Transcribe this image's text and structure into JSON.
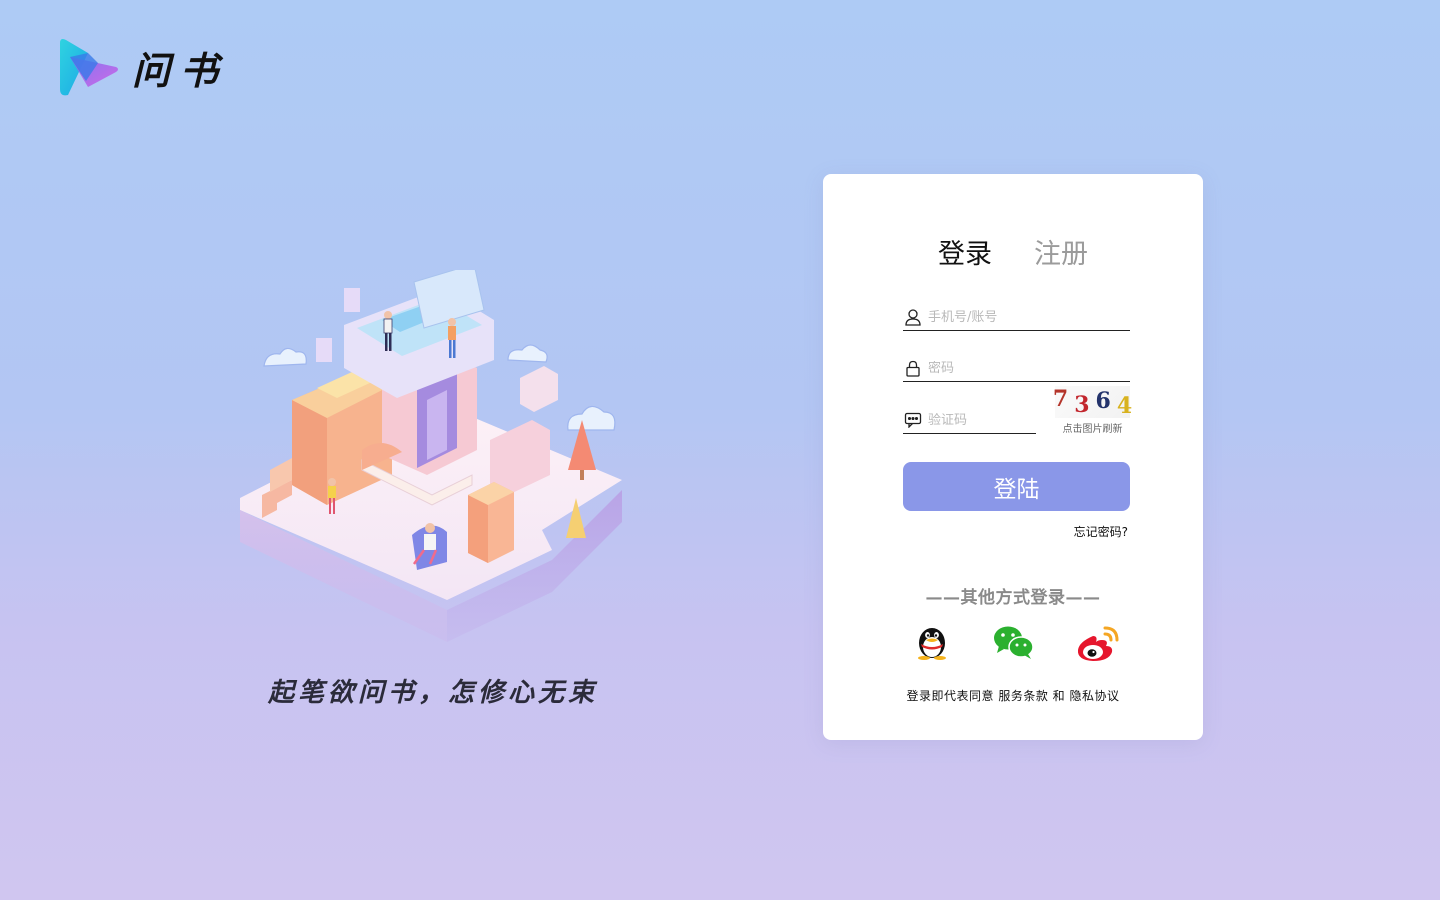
{
  "brand": {
    "name": "问书",
    "icon": "play-logo-icon"
  },
  "illustration": {
    "icon": "isometric-city-illustration"
  },
  "slogan": "起笔欲问书，怎修心无束",
  "auth": {
    "tabs": [
      {
        "label": "登录",
        "active": true
      },
      {
        "label": "注册",
        "active": false
      }
    ],
    "account_placeholder": "手机号/账号",
    "password_placeholder": "密码",
    "code_placeholder": "验证码",
    "captcha": {
      "digits": [
        "7",
        "3",
        "6",
        "4"
      ],
      "hint": "点击图片刷新"
    },
    "submit_label": "登陆",
    "forgot_label": "忘记密码?",
    "other_login_title": "——其他方式登录——",
    "socials": [
      {
        "name": "qq-icon"
      },
      {
        "name": "wechat-icon"
      },
      {
        "name": "weibo-icon"
      }
    ],
    "agreement": {
      "prefix": "登录即代表同意",
      "terms": "服务条款",
      "and": "和",
      "privacy": "隐私协议"
    }
  },
  "colors": {
    "bg_top": "#aecbf5",
    "bg_bottom": "#d0c6f0",
    "button": "#8a97e8",
    "card": "#ffffff"
  }
}
